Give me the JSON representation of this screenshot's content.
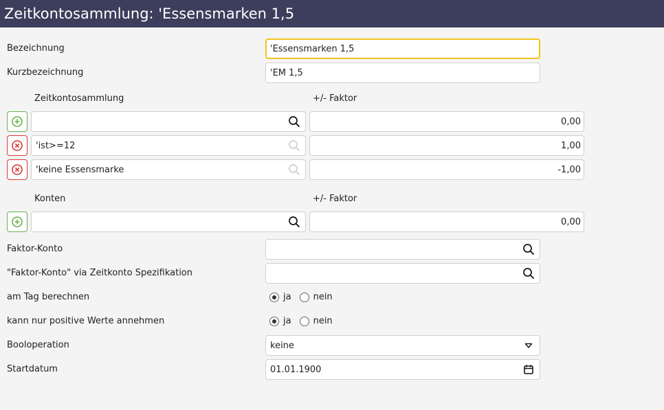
{
  "title": "Zeitkontosammlung: 'Essensmarken 1,5",
  "fields": {
    "bezeichnung": {
      "label": "Bezeichnung",
      "value": "'Essensmarken 1,5"
    },
    "kurzbezeichnung": {
      "label": "Kurzbezeichnung",
      "value": "'EM 1,5"
    }
  },
  "zeitkontosammlung": {
    "header": "Zeitkontosammlung",
    "faktor_header": "+/- Faktor",
    "rows": [
      {
        "name": "",
        "faktor": "0,00",
        "action": "add"
      },
      {
        "name": "'ist>=12",
        "faktor": "1,00",
        "action": "remove"
      },
      {
        "name": "'keine Essensmarke",
        "faktor": "-1,00",
        "action": "remove"
      }
    ]
  },
  "konten": {
    "header": "Konten",
    "faktor_header": "+/- Faktor",
    "rows": [
      {
        "name": "",
        "faktor": "0,00",
        "action": "add"
      }
    ]
  },
  "faktor_konto": {
    "label": "Faktor-Konto",
    "value": ""
  },
  "faktor_konto_spez": {
    "label": "\"Faktor-Konto\" via Zeitkonto Spezifikation",
    "value": ""
  },
  "am_tag_berechnen": {
    "label": "am Tag berechnen",
    "ja": "ja",
    "nein": "nein",
    "selected": "ja"
  },
  "nur_positive": {
    "label": "kann nur positive Werte annehmen",
    "ja": "ja",
    "nein": "nein",
    "selected": "ja"
  },
  "booloperation": {
    "label": "Booloperation",
    "value": "keine"
  },
  "startdatum": {
    "label": "Startdatum",
    "value": "01.01.1900"
  },
  "colors": {
    "titlebar": "#3d3d5c",
    "add": "#6ab04c",
    "remove": "#d83a3a",
    "focus": "#f0c419"
  }
}
